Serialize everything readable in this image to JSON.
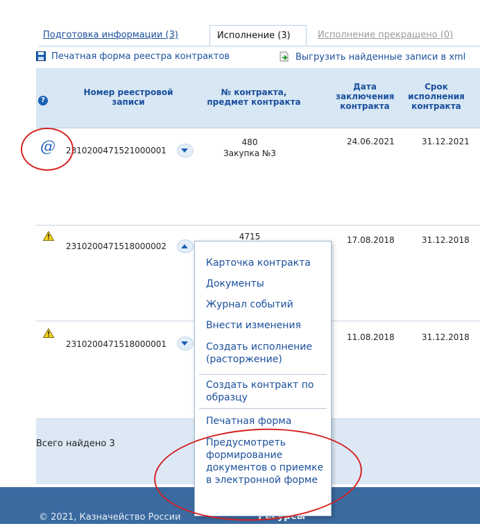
{
  "tabs": [
    {
      "label": "Подготовка информации (3)"
    },
    {
      "label": "Исполнение (3)"
    },
    {
      "label": "Исполнение прекращено (0)"
    }
  ],
  "toolbar": {
    "print_label": "Печатная форма реестра контрактов",
    "export_label": "Выгрузить найденные записи в xml"
  },
  "table": {
    "help_icon": "?",
    "headers": {
      "regno": "Номер реестровой записи",
      "contract": "№ контракта, предмет контракта",
      "date": "Дата заключения контракта",
      "term": "Срок исполнения контракта"
    },
    "rows": [
      {
        "regno": "2310200471521000001",
        "contract_no": "480",
        "subject": "Закупка №3",
        "date": "24.06.2021",
        "term": "31.12.2021",
        "status_icon": "at-icon"
      },
      {
        "regno": "2310200471518000002",
        "contract_no": "4715",
        "subject": "",
        "date": "17.08.2018",
        "term": "31.12.2018",
        "status_icon": "warning-icon"
      },
      {
        "regno": "2310200471518000001",
        "contract_no": "",
        "subject": "",
        "date": "11.08.2018",
        "term": "31.12.2018",
        "status_icon": "warning-icon"
      }
    ],
    "total": "Всего найдено 3"
  },
  "menu": {
    "items": [
      "Карточка контракта",
      "Документы",
      "Журнал событий",
      "Внести изменения",
      "Создать исполнение (расторжение)",
      "Создать контракт по образцу",
      "Печатная форма",
      "Предусмотреть формирование документов о приемке в электронной форме"
    ]
  },
  "footer": {
    "copyright": "© 2021, Казначейство России",
    "resources": "Ресурсы"
  },
  "colors": {
    "link": "#1a4f9c",
    "header_bg": "#d8e7f4",
    "bottombar": "#3a6aa0",
    "annotation": "#d42020"
  }
}
